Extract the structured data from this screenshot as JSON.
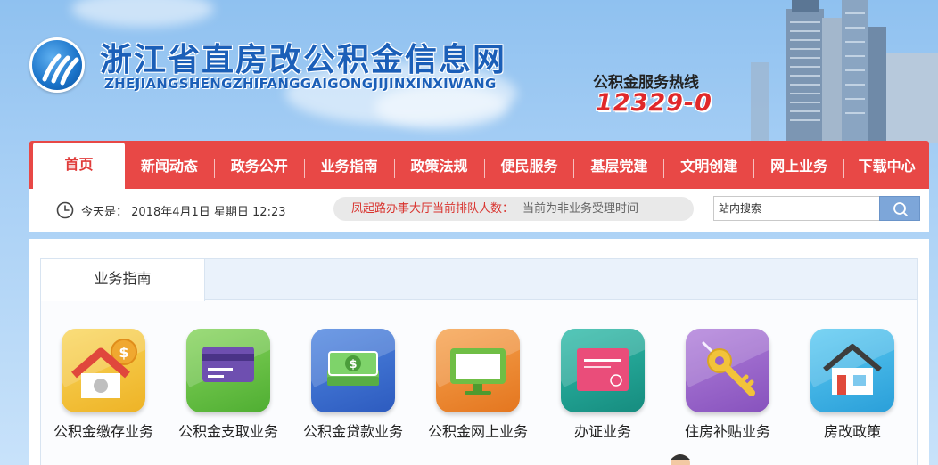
{
  "header": {
    "title": "浙江省直房改公积金信息网",
    "subtitle": "ZHEJIANGSHENGZHIFANGGAIGONGJIJINXINXIWANG",
    "hotline_label": "公积金服务热线",
    "hotline_number": "12329-0"
  },
  "nav": {
    "items": [
      {
        "label": "首页",
        "active": true
      },
      {
        "label": "新闻动态"
      },
      {
        "label": "政务公开"
      },
      {
        "label": "业务指南"
      },
      {
        "label": "政策法规"
      },
      {
        "label": "便民服务"
      },
      {
        "label": "基层党建"
      },
      {
        "label": "文明创建"
      },
      {
        "label": "网上业务"
      },
      {
        "label": "下载中心"
      }
    ]
  },
  "infobar": {
    "date_text": "今天是： 2018年4月1日  星期日 12:23",
    "queue_label": "凤起路办事大厅当前排队人数：",
    "queue_value": "当前为非业务受理时间",
    "search_placeholder": "站内搜索"
  },
  "section": {
    "tab_label": "业务指南",
    "tiles": [
      {
        "label": "公积金缴存业务",
        "icon": "house-coin-icon",
        "color": "#f5c43a"
      },
      {
        "label": "公积金支取业务",
        "icon": "card-icon",
        "color": "#6fc44a"
      },
      {
        "label": "公积金贷款业务",
        "icon": "money-icon",
        "color": "#3d6fd0"
      },
      {
        "label": "公积金网上业务",
        "icon": "monitor-icon",
        "color": "#f08a34"
      },
      {
        "label": "办证业务",
        "icon": "certificate-icon",
        "color": "#22a89a"
      },
      {
        "label": "住房补贴业务",
        "icon": "key-icon",
        "color": "#9b64c8"
      },
      {
        "label": "房改政策",
        "icon": "home-policy-icon",
        "color": "#3fb6e8"
      }
    ]
  },
  "colors": {
    "nav_bg": "#e84846",
    "title_blue": "#1b5fb8",
    "hotline_red": "#e0282a"
  }
}
